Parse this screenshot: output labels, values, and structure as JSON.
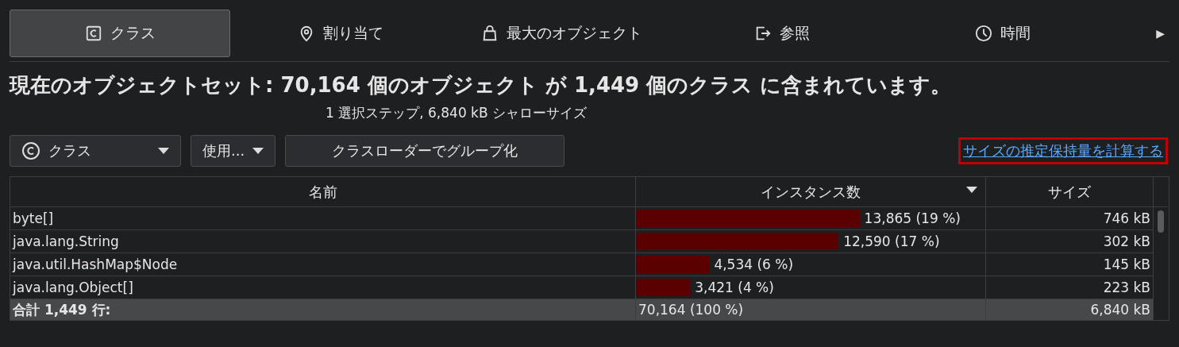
{
  "tabs": [
    {
      "label": "クラス",
      "kind": "class",
      "selected": true
    },
    {
      "label": "割り当て",
      "kind": "allocation",
      "selected": false
    },
    {
      "label": "最大のオブジェクト",
      "kind": "largest",
      "selected": false
    },
    {
      "label": "参照",
      "kind": "reference",
      "selected": false
    },
    {
      "label": "時間",
      "kind": "time",
      "selected": false
    }
  ],
  "tabs_more": "▶",
  "summary": {
    "title": "現在のオブジェクトセット:  **70,164** 個のオブジェクト が **1,449** 個のクラス に含まれています。",
    "subtitle": "1 選択ステップ, 6,840 kB シャローサイズ"
  },
  "toolbar": {
    "view_dropdown": "クラス",
    "usage_dropdown": "使用...",
    "group_button": "クラスローダーでグループ化",
    "link": "サイズの推定保持量を計算する"
  },
  "table": {
    "columns": [
      {
        "label": "名前",
        "sort_descending": false
      },
      {
        "label": "インスタンス数",
        "sort_descending": true
      },
      {
        "label": "サイズ",
        "sort_descending": false
      }
    ],
    "rows": [
      {
        "name": "byte[]",
        "instances": "13,865 (19 %)",
        "level": 0.64,
        "size": "746 kB"
      },
      {
        "name": "java.lang.String",
        "instances": "12,590 (17 %)",
        "level": 0.58,
        "size": "302 kB"
      },
      {
        "name": "java.util.HashMap$Node",
        "instances": "4,534 (6 %)",
        "level": 0.21,
        "size": "145 kB"
      },
      {
        "name": "java.lang.Object[]",
        "instances": "3,421 (4 %)",
        "level": 0.155,
        "size": "223 kB"
      }
    ],
    "total": {
      "name": "合計 1,449 行:",
      "instances": "70,164 (100 %)",
      "size": "6,840 kB"
    }
  }
}
